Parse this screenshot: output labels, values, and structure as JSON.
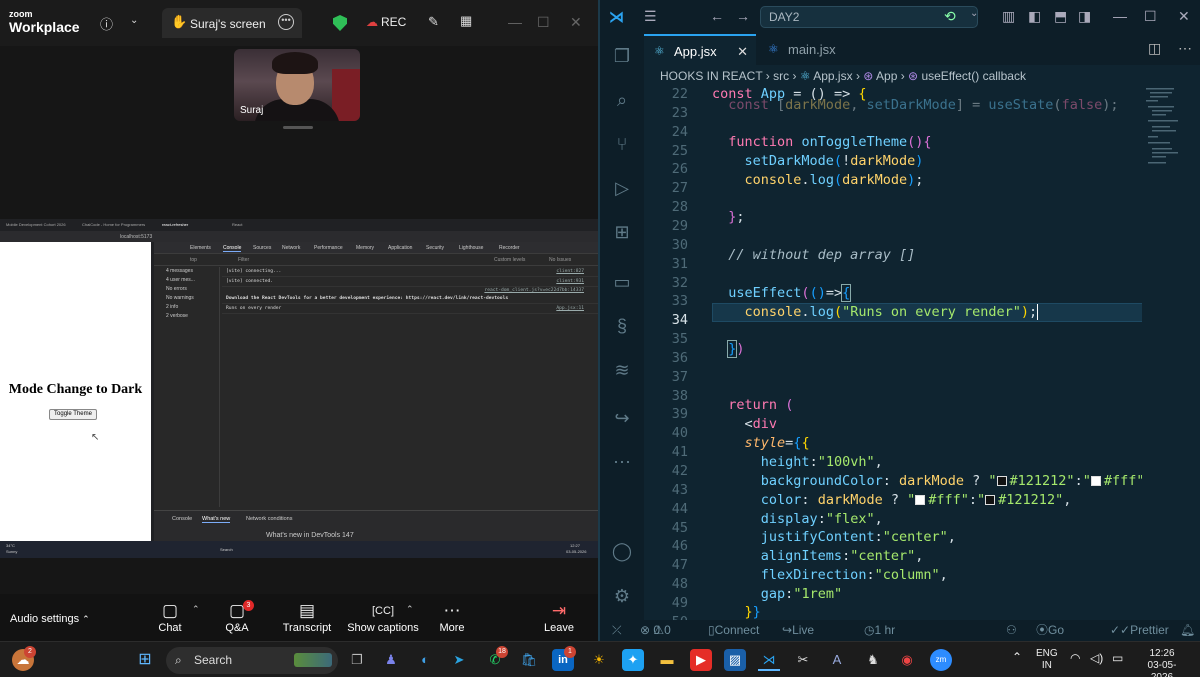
{
  "zoom": {
    "brand_top": "zoom",
    "brand_bottom": "Workplace",
    "share_tab": "Suraj's screen",
    "rec_label": "REC",
    "participant_name": "Suraj",
    "audio_settings": "Audio settings",
    "buttons": [
      {
        "label": "Chat",
        "icon": "chat-icon"
      },
      {
        "label": "Q&A",
        "icon": "qa-icon",
        "badge": "3"
      },
      {
        "label": "Transcript",
        "icon": "transcript-icon"
      },
      {
        "label": "Show captions",
        "icon": "captions-icon"
      },
      {
        "label": "More",
        "icon": "more-icon"
      },
      {
        "label": "Leave",
        "icon": "leave-icon"
      }
    ]
  },
  "shared": {
    "browser_tabs": [
      "Mobile Development Cohort 2026",
      "ChaiCode - Home for Programmers",
      "react-refresher",
      "React"
    ],
    "address": "localhost:5173",
    "page_heading": "Mode Change to Dark",
    "page_button": "Toggle Theme",
    "devtools_tabs": [
      "Elements",
      "Console",
      "Sources",
      "Network",
      "Performance",
      "Memory",
      "Application",
      "Security",
      "Lighthouse",
      "Recorder"
    ],
    "devtools_active_tab": "Console",
    "filter_context": "top",
    "filter_placeholder": "Filter",
    "custom_levels": "Custom levels",
    "no_issues": "No Issues",
    "sidebar": [
      "4 messages",
      "4 user mes...",
      "No errors",
      "No warnings",
      "2 info",
      "2 verbose"
    ],
    "logs": [
      {
        "text": "[vite] connecting...",
        "src": "client:827"
      },
      {
        "text": "[vite] connected.",
        "src": "client:931"
      },
      {
        "text": "",
        "src": "react-dom_client.js?v=ec22d7bb:14337"
      },
      {
        "text": "Download the React DevTools for a better development experience: https://react.dev/link/react-devtools",
        "src": ""
      },
      {
        "text": "Runs on every render",
        "src": "App.jsx:11"
      }
    ],
    "drawer_tabs": [
      "Console",
      "What's new",
      "Network conditions"
    ],
    "drawer_news": "What's new in DevTools 147",
    "weather_temp": "34°C",
    "weather_desc": "Sunny",
    "taskbar_search": "Search",
    "tray_time": "12:27",
    "tray_date": "03-05-2026"
  },
  "vscode": {
    "search_placeholder": "DAY2",
    "tabs": [
      {
        "label": "App.jsx",
        "active": true
      },
      {
        "label": "main.jsx",
        "active": false
      }
    ],
    "breadcrumb": [
      "HOOKS IN REACT",
      "src",
      "App.jsx",
      "App",
      "useEffect() callback"
    ],
    "line_numbers": [
      "22",
      "23",
      "24",
      "25",
      "26",
      "27",
      "28",
      "29",
      "30",
      "31",
      "32",
      "33",
      "34",
      "35",
      "36",
      "37",
      "38",
      "39",
      "40",
      "41",
      "42",
      "43",
      "44",
      "45",
      "46",
      "47",
      "48",
      "49",
      "50"
    ],
    "current_line": "34",
    "status": {
      "problems_errors": "0",
      "problems_warnings": "0",
      "connect": "Connect",
      "live_share": "Live Share",
      "timer": "1 hr 21 mins",
      "go_live": "Go Live",
      "prettier": "Prettier"
    }
  },
  "taskbar": {
    "weather_badge": "2",
    "search": "Search",
    "whatsapp_badge": "18",
    "linkedin_badge": "1",
    "lang": "ENG",
    "region": "IN",
    "time": "12:26",
    "date": "03-05-2026"
  }
}
